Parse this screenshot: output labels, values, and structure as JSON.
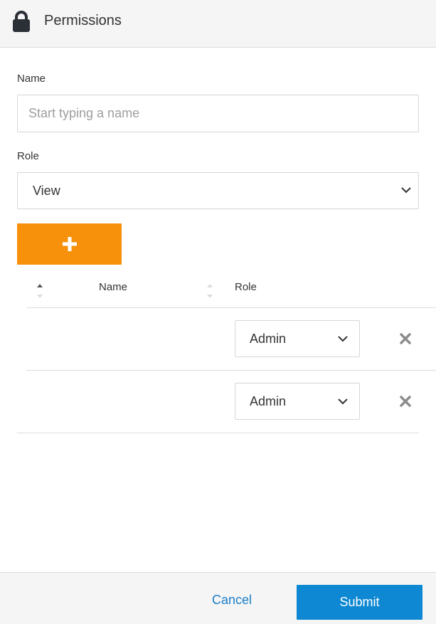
{
  "header": {
    "title": "Permissions",
    "icon": "lock-icon"
  },
  "form": {
    "name_label": "Name",
    "name_placeholder": "Start typing a name",
    "name_value": "",
    "role_label": "Role",
    "role_value": "View",
    "add_icon": "plus-icon"
  },
  "table": {
    "columns": [
      "Name",
      "Role"
    ],
    "rows": [
      {
        "name": "",
        "role": "Admin"
      },
      {
        "name": "",
        "role": "Admin"
      }
    ]
  },
  "footer": {
    "cancel_label": "Cancel",
    "submit_label": "Submit"
  },
  "colors": {
    "accent_orange": "#f7900a",
    "primary_blue": "#0e88d3",
    "link_blue": "#1a7ec8",
    "header_bg": "#f5f5f5"
  }
}
